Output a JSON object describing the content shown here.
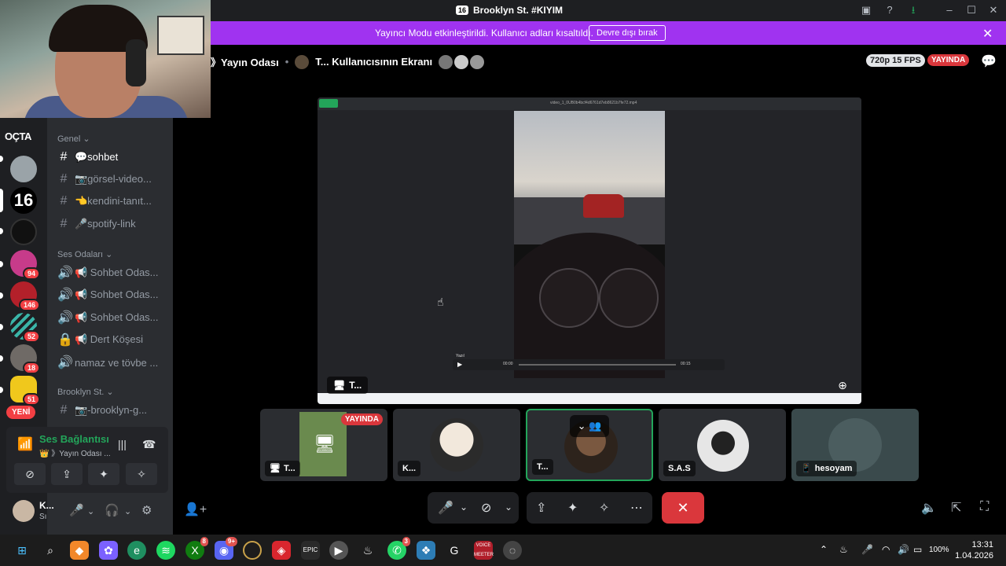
{
  "window": {
    "server_badge": "16",
    "title": "Brooklyn St. #KIYIM"
  },
  "banner": {
    "message": "Yayıncı Modu etkinleştirildi. Kullanıcı adları kısaltıldı.",
    "button": "Devre dışı bırak",
    "close_icon": "close-icon"
  },
  "rail": {
    "top_label": "OÇTA",
    "servers": [
      {
        "name": "server-1",
        "badge": "",
        "color": "#9aa3a8"
      },
      {
        "name": "server-16",
        "badge": "",
        "color": "#000000"
      },
      {
        "name": "server-3",
        "badge": "",
        "color": "#111111"
      },
      {
        "name": "server-4",
        "badge": "94",
        "color": "#c73b8a"
      },
      {
        "name": "server-5",
        "badge": "146",
        "color": "#b3202a"
      },
      {
        "name": "server-albaytm",
        "badge": "52",
        "color": "#3ab5a8"
      },
      {
        "name": "server-7",
        "badge": "18",
        "color": "#6f6a66"
      },
      {
        "name": "server-8",
        "badge": "51",
        "color": "#f0c81c"
      }
    ],
    "new_label": "YENİ"
  },
  "channels": {
    "categories": [
      "Genel",
      "Ses Odaları",
      "Brooklyn St."
    ],
    "text": [
      {
        "label": "💬sohbet",
        "active": true
      },
      {
        "label": "📷görsel-video...",
        "active": false
      },
      {
        "label": "👈kendini-tanıt...",
        "active": false
      },
      {
        "label": "🎤spotify-link",
        "active": false
      }
    ],
    "voice": [
      "📢 Sohbet Odas...",
      "📢 Sohbet Odas...",
      "📢 Sohbet Odas...",
      "📢 Dert Köşesi",
      "namaz ve tövbe ..."
    ],
    "brooklyn": [
      "📷-brooklyn-g..."
    ]
  },
  "voice_panel": {
    "title": "Ses Bağlantısı K",
    "subtitle": "👑 》Yayın Odası ..."
  },
  "user_panel": {
    "name": "K...",
    "status": "Sı"
  },
  "stream": {
    "breadcrumb_room": "》Yayın Odası",
    "breadcrumb_screen": "T... Kullanıcısının Ekranı",
    "quality": "720p 15 FPS",
    "live": "YAYINDA",
    "screen_label": "T...",
    "file_name": "video_1_0UB0b4bcf4d6761d7eb8621b7fe72.mp4",
    "tooltip": "Yazıl",
    "time_start": "00:00",
    "time_end": "00:15"
  },
  "tiles": [
    {
      "label": "T...",
      "live": "YAYINDA",
      "icon": "monitor-icon"
    },
    {
      "label": "K...",
      "live": "",
      "icon": ""
    },
    {
      "label": "T...",
      "live": "",
      "icon": ""
    },
    {
      "label": "S.A.S",
      "live": "",
      "icon": ""
    },
    {
      "label": "hesoyam",
      "live": "",
      "icon": "phone-icon"
    }
  ],
  "taskbar": {
    "time": "13:31",
    "date": "1.04.2026",
    "battery": "100%",
    "badges": {
      "xbox": "8",
      "discord": "9+",
      "whatsapp": "3"
    },
    "voicemeeter_label": "VOICE MEETER"
  },
  "colors": {
    "accent": "#a033f0",
    "live": "#da373c",
    "online": "#23a55a"
  }
}
